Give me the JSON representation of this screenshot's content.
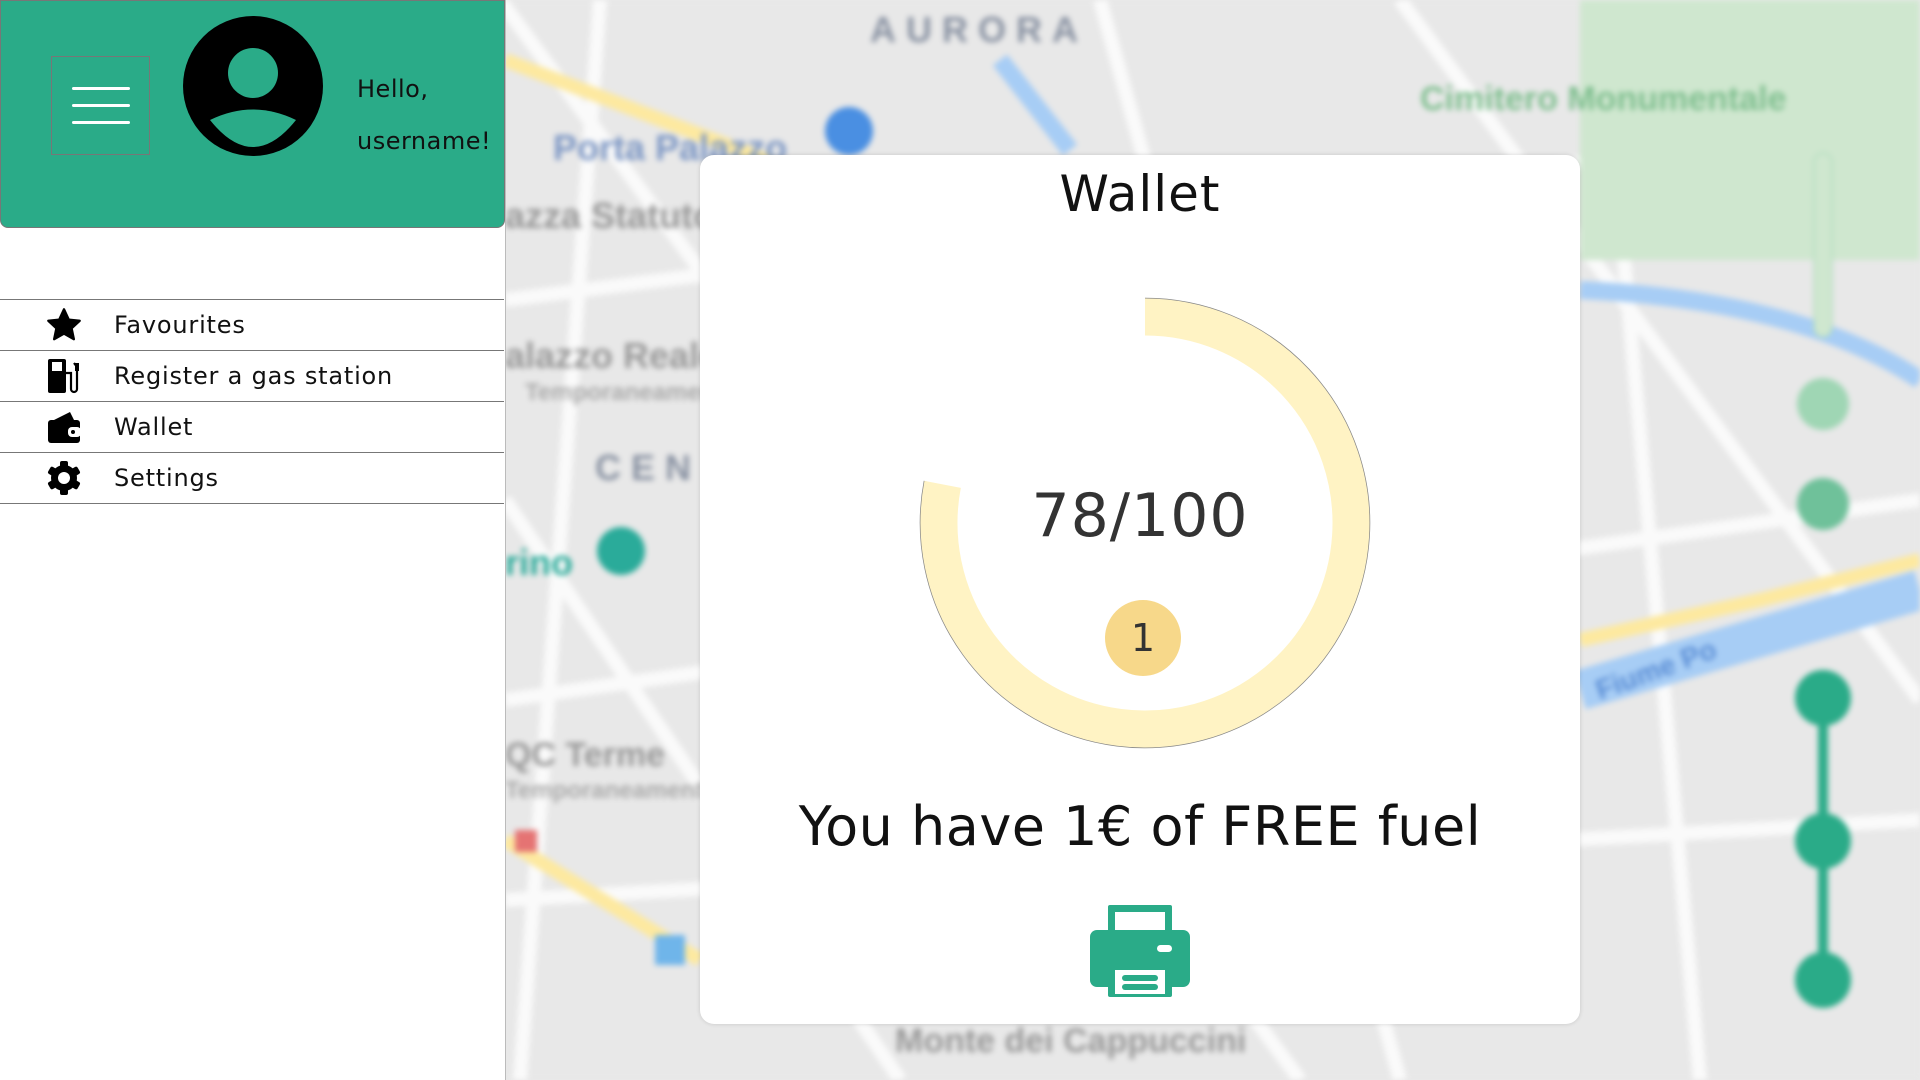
{
  "header": {
    "greeting_line1": "Hello,",
    "greeting_line2": "username!",
    "accent_color": "#2aab88"
  },
  "menu": {
    "items": [
      {
        "label": "Favourites",
        "icon": "star-icon"
      },
      {
        "label": "Register a gas station",
        "icon": "gas-pump-icon"
      },
      {
        "label": "Wallet",
        "icon": "wallet-icon"
      },
      {
        "label": "Settings",
        "icon": "gear-icon"
      }
    ]
  },
  "wallet": {
    "title": "Wallet",
    "points": 78,
    "points_max": 100,
    "score_text": "78/100",
    "coins": "1",
    "message": "You have 1€ of FREE fuel",
    "print_icon": "printer-icon",
    "ring_color": "#fff3c4",
    "coin_color": "#f7d88a"
  },
  "map": {
    "labels": [
      "AURORA",
      "Porta Palazzo",
      "Cimitero Monumentale",
      "azza Statuto",
      "alazzo Reale",
      "Temporaneamente",
      "CEN",
      "rino",
      "QC Terme",
      "Temporaneament",
      "Monte dei Cappuccini",
      "Fiume Po"
    ]
  }
}
